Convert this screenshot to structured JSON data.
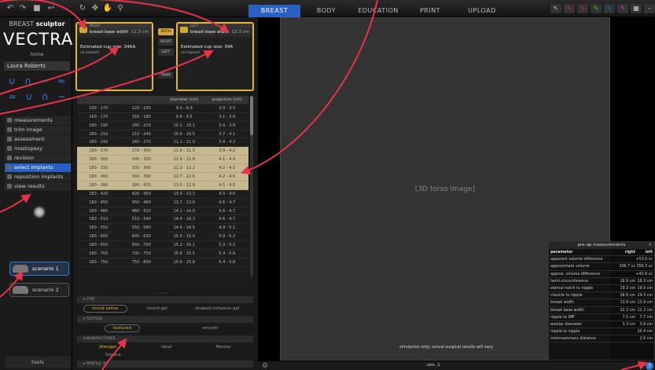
{
  "topbar": {
    "tabs": [
      {
        "label": "BREAST",
        "active": true
      },
      {
        "label": "BODY",
        "active": false
      },
      {
        "label": "EDUCATION",
        "active": false
      },
      {
        "label": "PRINT",
        "active": false
      },
      {
        "label": "UPLOAD",
        "active": false
      }
    ]
  },
  "left": {
    "brand_prefix": "BREAST",
    "brand_name": "sculptor",
    "logo": "VECTRA",
    "home": "home",
    "patient_name": "Laura Roberts",
    "menu": [
      {
        "label": "measurements",
        "active": false
      },
      {
        "label": "trim image",
        "active": false
      },
      {
        "label": "assessment",
        "active": false
      },
      {
        "label": "mastopexy",
        "active": false
      },
      {
        "label": "revision",
        "active": false
      },
      {
        "label": "select implants",
        "active": true
      },
      {
        "label": "reposition implants",
        "active": false
      },
      {
        "label": "view results",
        "active": false
      }
    ],
    "scenarios": [
      {
        "label": "scenario 1",
        "active": true
      },
      {
        "label": "scenario 2",
        "active": false
      }
    ],
    "tools_label": "tools"
  },
  "implant": {
    "right": {
      "side": "RIGHT",
      "metric": "breast base width",
      "value": "12.3 cm",
      "cup": "Estimated cup size: 34AA",
      "implant": "no implant"
    },
    "left": {
      "side": "LEFT",
      "metric": "breast base width",
      "value": "12.3 cm",
      "cup": "Estimated cup size: 34A",
      "implant": "no implant"
    },
    "side_buttons": [
      "BOTH",
      "RIGHT",
      "LEFT",
      "Apply"
    ],
    "table": {
      "headers": [
        "",
        "",
        "diameter (cm)",
        "projection (cm)"
      ],
      "rows": [
        {
          "vol": "100 - 170",
          "range": "120 - 150",
          "diam": "9.0 - 8.9",
          "proj": "3.0 - 3.5",
          "hl": false
        },
        {
          "vol": "160 - 170",
          "range": "150 - 180",
          "diam": "9.6 - 9.5",
          "proj": "3.1 - 3.8",
          "hl": false
        },
        {
          "vol": "180 - 190",
          "range": "180 - 210",
          "diam": "10.2 - 10.1",
          "proj": "3.4 - 3.8",
          "hl": false
        },
        {
          "vol": "180 - 210",
          "range": "210 - 240",
          "diam": "10.6 - 10.5",
          "proj": "3.7 - 4.1",
          "hl": false
        },
        {
          "vol": "180 - 240",
          "range": "240 - 270",
          "diam": "11.1 - 11.0",
          "proj": "3.8 - 4.2",
          "hl": false
        },
        {
          "vol": "180 - 270",
          "range": "270 - 300",
          "diam": "11.6 - 11.5",
          "proj": "3.9 - 4.2",
          "hl": true
        },
        {
          "vol": "180 - 300",
          "range": "300 - 330",
          "diam": "11.9 - 11.8",
          "proj": "4.1 - 4.4",
          "hl": true
        },
        {
          "vol": "180 - 330",
          "range": "330 - 360",
          "diam": "12.3 - 12.2",
          "proj": "4.2 - 4.5",
          "hl": true
        },
        {
          "vol": "180 - 360",
          "range": "360 - 390",
          "diam": "12.7 - 12.6",
          "proj": "4.2 - 4.5",
          "hl": true
        },
        {
          "vol": "180 - 390",
          "range": "390 - 420",
          "diam": "13.0 - 12.9",
          "proj": "4.5 - 4.8",
          "hl": true
        },
        {
          "vol": "180 - 420",
          "range": "420 - 450",
          "diam": "13.4 - 13.3",
          "proj": "4.5 - 4.6",
          "hl": false
        },
        {
          "vol": "180 - 450",
          "range": "450 - 480",
          "diam": "13.7 - 13.6",
          "proj": "4.6 - 4.7",
          "hl": false
        },
        {
          "vol": "180 - 480",
          "range": "480 - 510",
          "diam": "14.1 - 14.0",
          "proj": "4.6 - 4.7",
          "hl": false
        },
        {
          "vol": "180 - 510",
          "range": "510 - 540",
          "diam": "14.4 - 14.3",
          "proj": "4.6 - 4.7",
          "hl": false
        },
        {
          "vol": "180 - 550",
          "range": "550 - 580",
          "diam": "14.6 - 14.5",
          "proj": "4.9 - 5.1",
          "hl": false
        },
        {
          "vol": "180 - 600",
          "range": "600 - 630",
          "diam": "15.0 - 15.0",
          "proj": "5.0 - 5.2",
          "hl": false
        },
        {
          "vol": "180 - 650",
          "range": "650 - 700",
          "diam": "15.2 - 15.1",
          "proj": "5.3 - 5.5",
          "hl": false
        },
        {
          "vol": "180 - 700",
          "range": "700 - 750",
          "diam": "15.6 - 15.5",
          "proj": "5.4 - 5.6",
          "hl": false
        },
        {
          "vol": "180 - 750",
          "range": "750 - 800",
          "diam": "15.9 - 15.8",
          "proj": "5.4 - 5.8",
          "hl": false
        }
      ]
    },
    "filters": {
      "type_header": "TYPE",
      "type_options": [
        {
          "label": "round saline",
          "sel": true
        },
        {
          "label": "round gel",
          "sel": false
        },
        {
          "label": "shaped cohesive gel",
          "sel": false
        }
      ],
      "texture_header": "TEXTURE",
      "texture_options": [
        {
          "label": "textured",
          "sel": true
        },
        {
          "label": "smooth",
          "sel": false
        }
      ],
      "manufacturer_header": "MANUFACTURER",
      "manufacturer_options": [
        {
          "label": "Allergan",
          "sel": true
        },
        {
          "label": "Ideal",
          "sel": false
        },
        {
          "label": "Mentor",
          "sel": false
        }
      ],
      "extra_option": "Sientra",
      "profile_header": "PROFILE: All"
    }
  },
  "viewport": {
    "photo_label": "[3D torso image]",
    "sim_note": "simulation only; actual surgical results will vary",
    "status": "sim. 1"
  },
  "measurements": {
    "title": "pre-op measurements",
    "headers": {
      "param": "parameter",
      "right": "right",
      "left": "left"
    },
    "rows": [
      {
        "p": "apparent volume difference",
        "r": "",
        "l": "+53.0 cc"
      },
      {
        "p": "approximate volume",
        "r": "306.7 cc",
        "l": "359.3 cc"
      },
      {
        "p": "approx. volume difference",
        "r": "",
        "l": "+42.6 cc"
      },
      {
        "p": "hemi-circumference",
        "r": "16.9 cm",
        "l": "18.3 cm"
      },
      {
        "p": "sternal notch to nipple",
        "r": "19.3 cm",
        "l": "19.9 cm"
      },
      {
        "p": "clavicle to nipple",
        "r": "18.8 cm",
        "l": "19.3 cm"
      },
      {
        "p": "breast width",
        "r": "13.9 cm",
        "l": "13.9 cm"
      },
      {
        "p": "breast base width",
        "r": "12.3 cm",
        "l": "12.3 cm"
      },
      {
        "p": "nipple to IMF",
        "r": "7.5 cm",
        "l": "7.7 cm"
      },
      {
        "p": "areolar diameter",
        "r": "3.3 cm",
        "l": "3.9 cm"
      },
      {
        "p": "nipple to nipple",
        "r": "",
        "l": "20.4 cm"
      },
      {
        "p": "intermammary distance",
        "r": "",
        "l": "2.6 cm"
      }
    ]
  }
}
